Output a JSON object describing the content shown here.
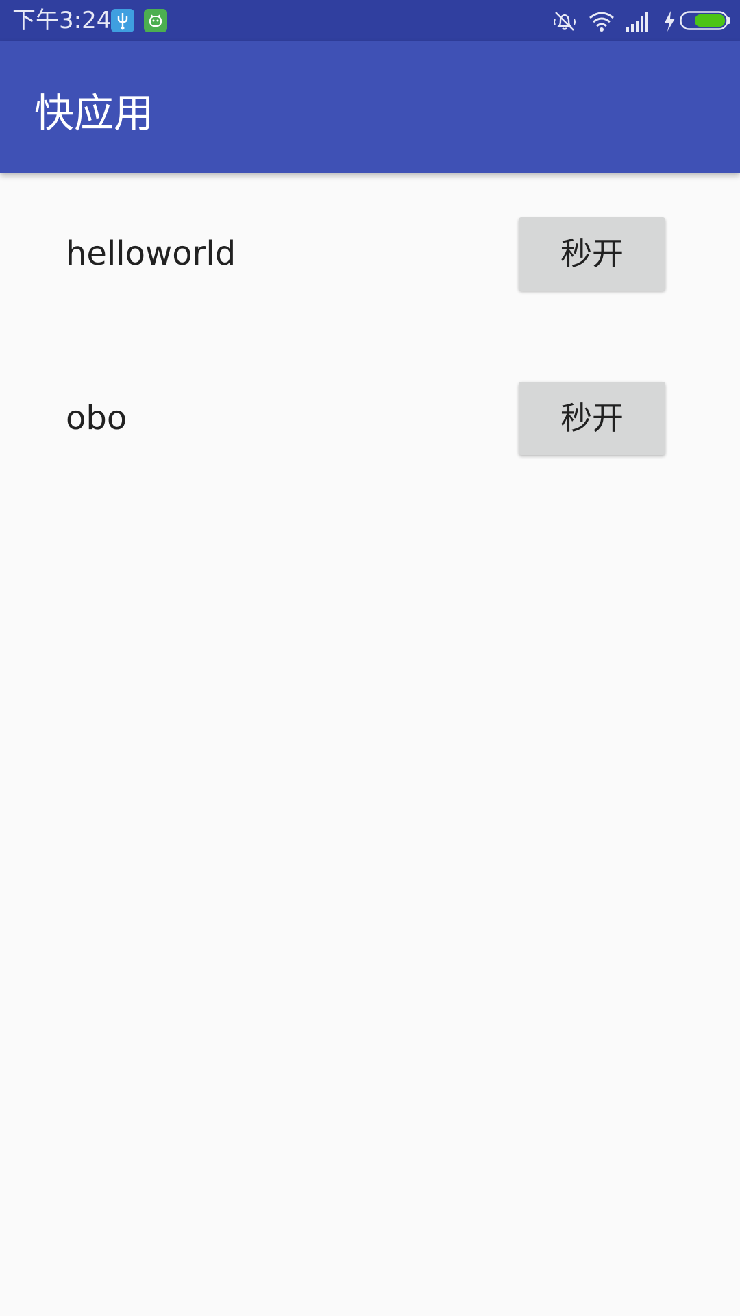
{
  "status_bar": {
    "time": "下午3:24",
    "notifications": [
      {
        "icon": "usb-icon",
        "color": "#3f9fe0"
      },
      {
        "icon": "android-app-icon",
        "color": "#4caf50"
      }
    ],
    "system_icons": [
      "silent-bell-icon",
      "wifi-icon",
      "signal-icon",
      "charging-icon",
      "battery-icon"
    ],
    "battery_color": "#4cc417"
  },
  "app_bar": {
    "title": "快应用",
    "color": "#3f51b5"
  },
  "list": {
    "items": [
      {
        "label": "helloworld",
        "button": "秒开"
      },
      {
        "label": "obo",
        "button": "秒开"
      }
    ]
  }
}
